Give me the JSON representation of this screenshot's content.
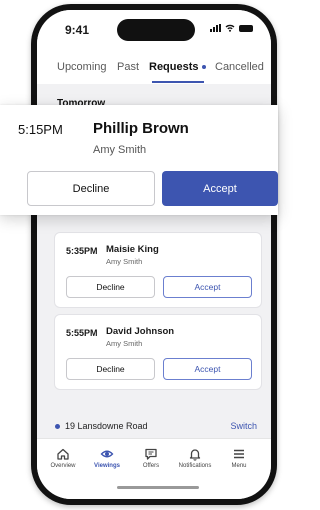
{
  "status": {
    "time": "9:41"
  },
  "tabs": [
    {
      "label": "Upcoming"
    },
    {
      "label": "Past"
    },
    {
      "label": "Requests"
    },
    {
      "label": "Cancelled"
    }
  ],
  "section": {
    "date": "Tomorrow"
  },
  "highlighted": {
    "time": "5:15PM",
    "name": "Phillip Brown",
    "agent": "Amy Smith",
    "decline": "Decline",
    "accept": "Accept"
  },
  "requests": [
    {
      "time": "5:35PM",
      "name": "Maisie King",
      "agent": "Amy Smith",
      "decline": "Decline",
      "accept": "Accept"
    },
    {
      "time": "5:55PM",
      "name": "David Johnson",
      "agent": "Amy Smith",
      "decline": "Decline",
      "accept": "Accept"
    }
  ],
  "property": {
    "address": "19 Lansdowne Road",
    "switch_label": "Switch"
  },
  "nav": [
    {
      "label": "Overview",
      "icon": "home-icon"
    },
    {
      "label": "Viewings",
      "icon": "eye-icon"
    },
    {
      "label": "Offers",
      "icon": "chat-icon"
    },
    {
      "label": "Notifications",
      "icon": "bell-icon"
    },
    {
      "label": "Menu",
      "icon": "menu-icon"
    }
  ],
  "colors": {
    "accent": "#3d55b0"
  }
}
